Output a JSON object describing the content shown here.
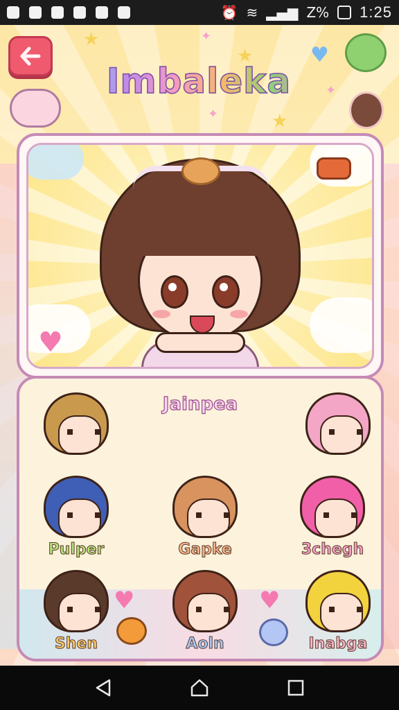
{
  "status_bar": {
    "time": "1:25",
    "battery_text": "Z%"
  },
  "header": {
    "title": "Imbaleka",
    "back_icon": "back-arrow-icon"
  },
  "hero": {
    "character": "selected-character-brown-hair-headband"
  },
  "selection": {
    "selected_name": "Jainpea",
    "characters": [
      {
        "label": "",
        "hair": "#c99a4e",
        "accent": "#7ec57a"
      },
      {
        "label": "",
        "hair": "#f3a6c6",
        "accent": "#b9d6f6"
      },
      {
        "label": "Pulper",
        "hair": "#3f5fb6",
        "accent": "#f39a5a",
        "label_color": "#b6e07a"
      },
      {
        "label": "Gapke",
        "hair": "#d9935e",
        "accent": "#9c5a3a",
        "label_color": "#f7b58a"
      },
      {
        "label": "3chegh",
        "hair": "#f15fa8",
        "accent": "#f5c342",
        "label_color": "#f6a2c7"
      },
      {
        "label": "Shen",
        "hair": "#5a3a2a",
        "accent": "#5a86c4",
        "label_color": "#f7c86a"
      },
      {
        "label": "Aoln",
        "hair": "#a0523a",
        "accent": "#f0a04a",
        "label_color": "#a7c8f6"
      },
      {
        "label": "Inabga",
        "hair": "#f2d33e",
        "accent": "#7ed0d8",
        "label_color": "#f6b2c8"
      }
    ]
  },
  "colors": {
    "accent": "#c58ab6",
    "back_button": "#f05a6e"
  },
  "nav": {
    "back": "nav-back-icon",
    "home": "nav-home-icon",
    "recents": "nav-recents-icon"
  }
}
